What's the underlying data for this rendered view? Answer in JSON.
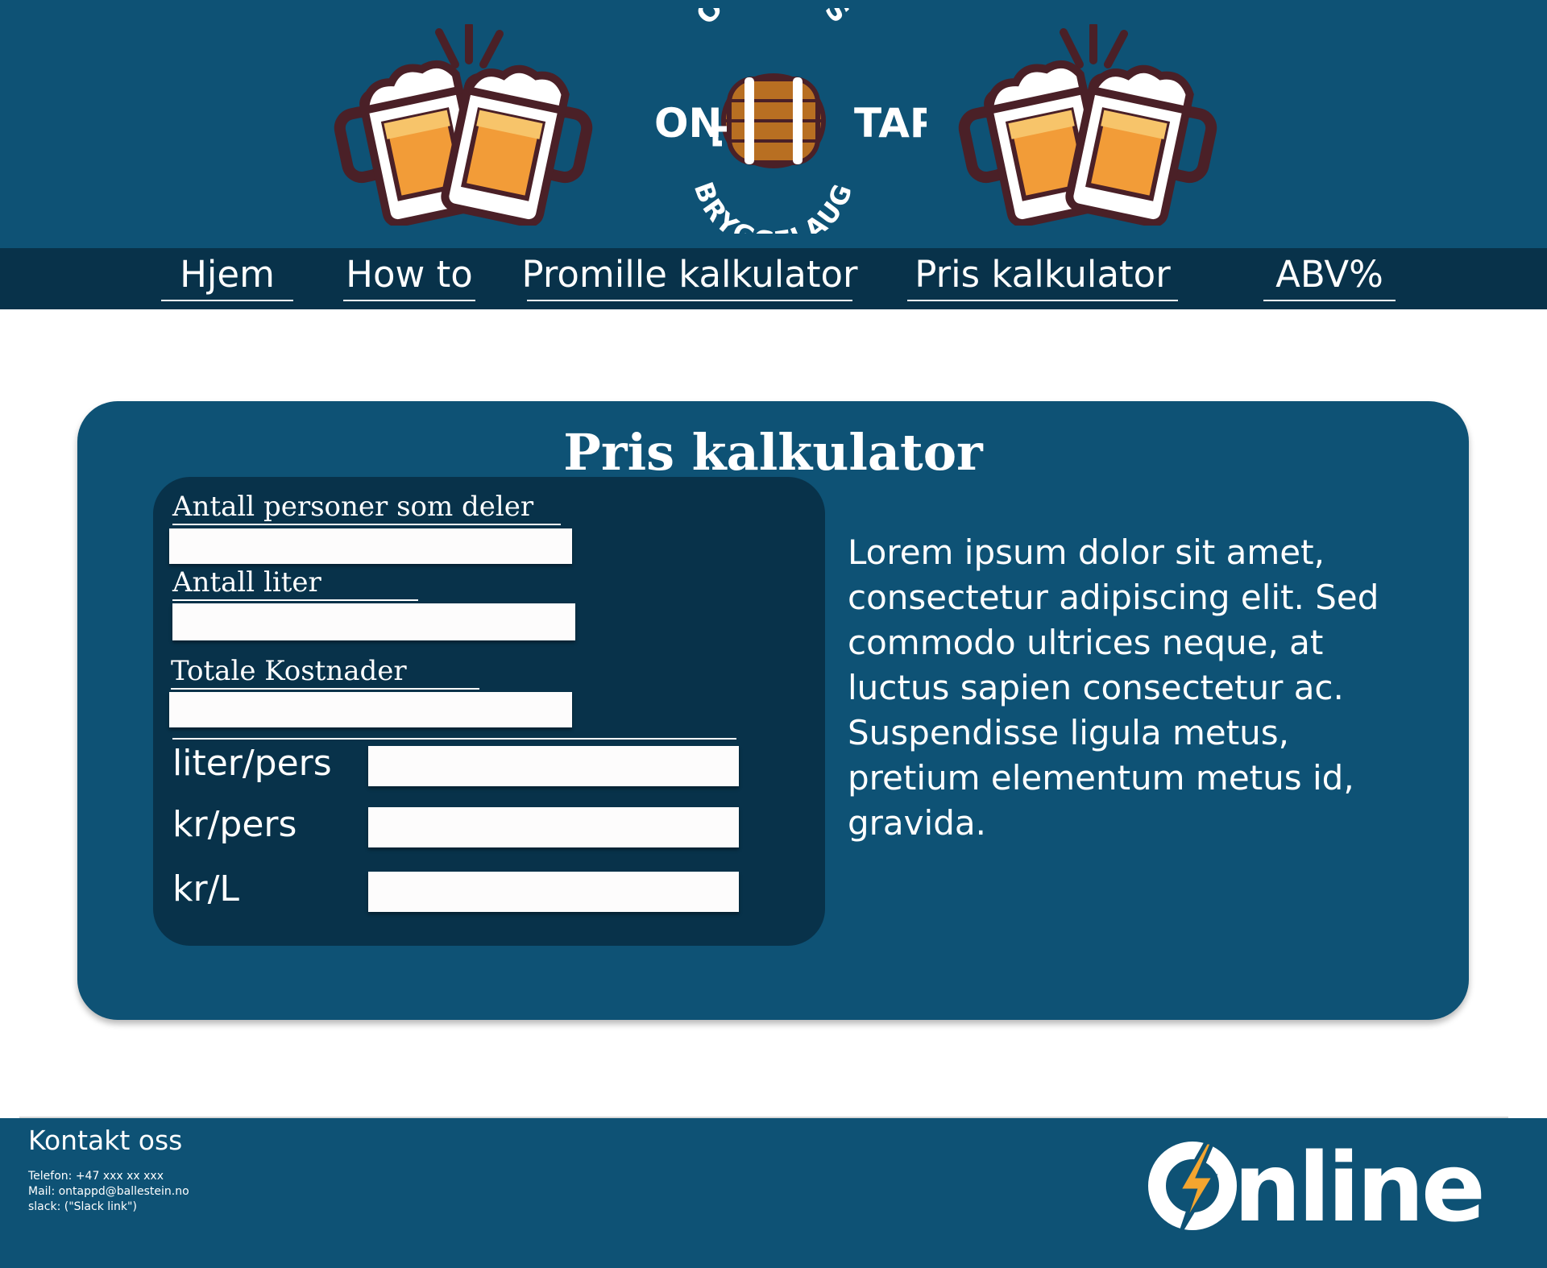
{
  "logo": {
    "top_arc": "ONLINES",
    "left_word": "ON",
    "right_word": "TAP",
    "bottom_arc": "BRYGGELAUG"
  },
  "nav": {
    "items": [
      {
        "label": "Hjem"
      },
      {
        "label": "How to"
      },
      {
        "label": "Promille kalkulator"
      },
      {
        "label": "Pris kalkulator"
      },
      {
        "label": "ABV%"
      }
    ]
  },
  "calculator": {
    "title": "Pris kalkulator",
    "fields": [
      {
        "label": "Antall personer som deler",
        "value": ""
      },
      {
        "label": "Antall liter",
        "value": ""
      },
      {
        "label": "Totale Kostnader",
        "value": ""
      }
    ],
    "results": [
      {
        "label": "liter/pers",
        "value": ""
      },
      {
        "label": "kr/pers",
        "value": ""
      },
      {
        "label": "kr/L",
        "value": ""
      }
    ],
    "description": "Lorem ipsum dolor sit amet, consectetur adipiscing elit. Sed commodo ultrices neque, at luctus sapien consectetur ac. Suspendisse ligula metus, pretium elementum metus id, gravida."
  },
  "footer": {
    "contact_title": "Kontakt oss",
    "phone": "Telefon: +47 xxx xx xxx",
    "mail": "Mail: ontappd@ballestein.no",
    "slack": "slack: (\"Slack link\")",
    "brand": "Online"
  },
  "colors": {
    "header_bg": "#0e5275",
    "nav_bg": "#08324a",
    "card_bg": "#0e5275",
    "inner_bg": "#08324a",
    "beer": "#f29c38",
    "mug_outline": "#4a2027",
    "bolt": "#f4a52f"
  },
  "icons": [
    "beer-mugs-cheers-icon",
    "barrel-icon",
    "lightning-bolt-icon"
  ]
}
